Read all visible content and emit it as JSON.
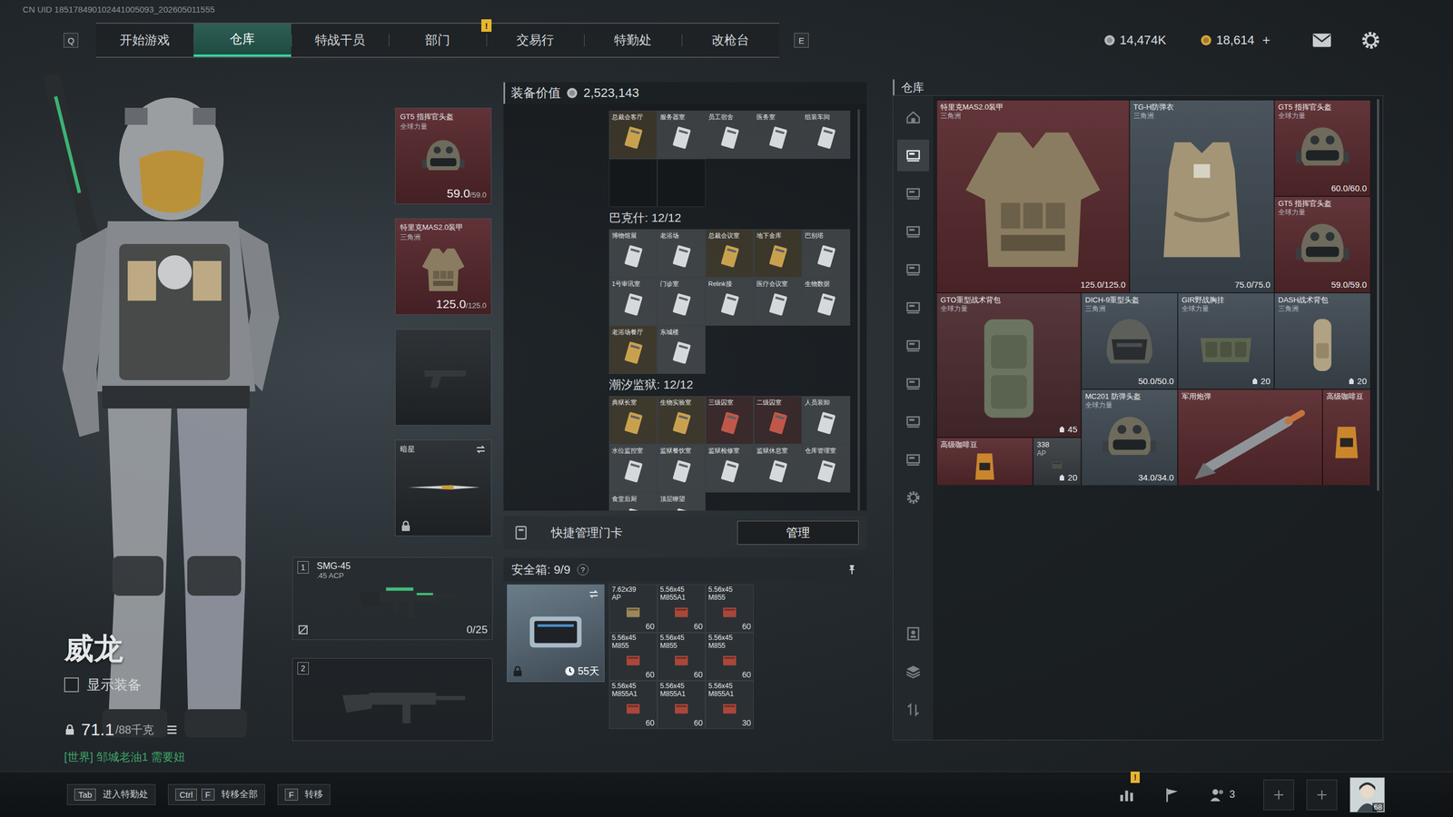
{
  "uid": "CN UID 185178490102441005093_202605011555",
  "nav": {
    "prev_key": "Q",
    "next_key": "E",
    "alert": "!",
    "tabs": [
      {
        "label": "开始游戏",
        "selected": false
      },
      {
        "label": "仓库",
        "selected": true
      },
      {
        "label": "特战干员",
        "selected": false
      },
      {
        "label": "部门",
        "selected": false
      },
      {
        "label": "交易行",
        "selected": false
      },
      {
        "label": "特勤处",
        "selected": false
      },
      {
        "label": "改枪台",
        "selected": false
      }
    ]
  },
  "currencies": [
    {
      "value": "14,474K",
      "color": "#b8bcc0"
    },
    {
      "value": "18,614",
      "add": "+",
      "color": "#d6a63a"
    }
  ],
  "operator": {
    "name": "威龙",
    "show_gear": {
      "label": "显示装备",
      "checked": false
    },
    "weight": "71.1",
    "weight_max": "/88千克"
  },
  "chat": "[世界] 邹城老油1 需要妞",
  "gear_slots": [
    {
      "kind": "helmet",
      "name": "GT5 指挥官头盔",
      "brand": "全球力量",
      "reading": "59.0",
      "reading_max": "/59.0",
      "color": "#5a2a2f"
    },
    {
      "kind": "armor",
      "name": "特里克MAS2.0装甲",
      "brand": "三角洲",
      "reading": "125.0",
      "reading_max": "/125.0",
      "color": "#5a2a2f"
    },
    {
      "kind": "pistol",
      "color": "#262b2f"
    },
    {
      "kind": "knife",
      "name": "暗星",
      "locked": true,
      "color": "#262b2f"
    }
  ],
  "weapons": [
    {
      "slot": "1",
      "name": "SMG-45",
      "caliber": ".45 ACP",
      "ammo": "0/25",
      "kind": "smg"
    },
    {
      "slot": "2",
      "kind": "rifle"
    }
  ],
  "equipment_value": {
    "label": "装备价值",
    "amount": "2,523,143"
  },
  "keycard_sections": [
    {
      "cards": [
        {
          "label": "总裁会客厅",
          "color": "#c9a14e"
        },
        {
          "label": "服务器室",
          "color": "#d5d9dc"
        },
        {
          "label": "员工宿舍",
          "color": "#d5d9dc"
        },
        {
          "label": "医务室",
          "color": "#d5d9dc"
        },
        {
          "label": "组装车间",
          "color": "#d5d9dc"
        }
      ]
    },
    {
      "title": "巴克什: 12/12",
      "cards": [
        {
          "label": "博物馆展",
          "color": "#d5d9dc"
        },
        {
          "label": "老浴场",
          "color": "#d5d9dc"
        },
        {
          "label": "总裁会议室",
          "color": "#c9a14e"
        },
        {
          "label": "地下金库",
          "color": "#c9a14e"
        },
        {
          "label": "巴别塔",
          "color": "#d5d9dc"
        },
        {
          "label": "1号审讯室",
          "color": "#d5d9dc"
        },
        {
          "label": "门诊室",
          "color": "#d5d9dc"
        },
        {
          "label": "Relink接",
          "color": "#d5d9dc"
        },
        {
          "label": "医疗会议室",
          "color": "#d5d9dc"
        },
        {
          "label": "生物数据",
          "color": "#d5d9dc"
        },
        {
          "label": "老浴场餐厅",
          "color": "#c9a14e"
        },
        {
          "label": "东城楼",
          "color": "#d5d9dc"
        }
      ]
    },
    {
      "title": "潮汐监狱: 12/12",
      "cards": [
        {
          "label": "典狱长室",
          "color": "#c9a14e"
        },
        {
          "label": "生物实验室",
          "color": "#c9a14e"
        },
        {
          "label": "三级囚室",
          "color": "#c0574a"
        },
        {
          "label": "二级囚室",
          "color": "#c0574a"
        },
        {
          "label": "人员装卸",
          "color": "#d5d9dc"
        },
        {
          "label": "水位监控室",
          "color": "#d5d9dc"
        },
        {
          "label": "监狱餐饮室",
          "color": "#d5d9dc"
        },
        {
          "label": "监狱检修室",
          "color": "#d5d9dc"
        },
        {
          "label": "监狱休息室",
          "color": "#d5d9dc"
        },
        {
          "label": "仓库管理室",
          "color": "#d5d9dc"
        },
        {
          "label": "食堂后厨",
          "color": "#d5d9dc"
        },
        {
          "label": "顶层瞭望",
          "color": "#d5d9dc"
        }
      ]
    }
  ],
  "quick_manage": {
    "label": "快捷管理门卡",
    "button": "管理"
  },
  "safebox": {
    "title": "安全箱: 9/9",
    "help": "?",
    "days": "55天",
    "locked": true,
    "items": [
      {
        "caliber": "7.62x39",
        "type": "AP",
        "count": "60",
        "color": "#9c8757"
      },
      {
        "caliber": "5.56x45",
        "type": "M855A1",
        "count": "60",
        "color": "#a8473a"
      },
      {
        "caliber": "5.56x45",
        "type": "M855",
        "count": "60",
        "color": "#a8473a"
      },
      {
        "caliber": "5.56x45",
        "type": "M855",
        "count": "60",
        "color": "#a8473a"
      },
      {
        "caliber": "5.56x45",
        "type": "M855",
        "count": "60",
        "color": "#a8473a"
      },
      {
        "caliber": "5.56x45",
        "type": "M855",
        "count": "60",
        "color": "#a8473a"
      },
      {
        "caliber": "5.56x45",
        "type": "M855A1",
        "count": "60",
        "color": "#a8473a"
      },
      {
        "caliber": "5.56x45",
        "type": "M855A1",
        "count": "60",
        "color": "#a8473a"
      },
      {
        "caliber": "5.56x45",
        "type": "M855A1",
        "count": "30",
        "color": "#a8473a"
      }
    ]
  },
  "stash": {
    "title": "仓库",
    "tabs": [
      {
        "selected": false
      },
      {
        "selected": true
      },
      {
        "selected": false
      },
      {
        "selected": false
      },
      {
        "selected": false
      },
      {
        "selected": false
      },
      {
        "selected": false
      },
      {
        "selected": false
      },
      {
        "selected": false
      },
      {
        "selected": false
      }
    ],
    "items": [
      {
        "name": "特里克MAS2.0装甲",
        "brand": "三角洲",
        "kind": "armor",
        "reading": "125.0/125.0",
        "color": "#5a2b2f"
      },
      {
        "name": "TG-H防弹衣",
        "brand": "三角洲",
        "kind": "vest",
        "reading": "75.0/75.0",
        "color": "#414b54"
      },
      {
        "name": "GT5 指挥官头盔",
        "brand": "全球力量",
        "kind": "helmet",
        "reading": "60.0/60.0",
        "color": "#5a2b2f"
      },
      {
        "name": "GT5 指挥官头盔",
        "brand": "全球力量",
        "kind": "helmet",
        "reading": "59.0/59.0",
        "color": "#5a2b2f"
      },
      {
        "name": "GTO重型战术背包",
        "brand": "全球力量",
        "kind": "backpack",
        "count": "45",
        "color": "#4e2d31"
      },
      {
        "name": "DICH-9重型头盔",
        "brand": "三角洲",
        "kind": "heavy-helmet",
        "reading": "50.0/50.0",
        "color": "#414b54"
      },
      {
        "name": "GIR野战胸挂",
        "brand": "全球力量",
        "kind": "rig",
        "count": "20",
        "color": "#414b54"
      },
      {
        "name": "DASH战术背包",
        "brand": "三角洲",
        "kind": "daypack",
        "count": "20",
        "color": "#414b54"
      },
      {
        "name": "高级咖啡豆",
        "kind": "coffee",
        "color": "#5a2b2f"
      },
      {
        "name": "338",
        "brand": "AP",
        "kind": "ammo",
        "count": "20",
        "color": "#3b3f44"
      },
      {
        "name": "MC201 防弹头盔",
        "brand": "全球力量",
        "kind": "helmet",
        "reading": "34.0/34.0",
        "color": "#414b54"
      },
      {
        "name": "军用炮弹",
        "kind": "shell",
        "color": "#5a2b2f"
      },
      {
        "name": "高级咖啡豆",
        "kind": "coffee",
        "color": "#5a2b2f"
      }
    ]
  },
  "hotkeys": [
    {
      "keys": [
        "Tab"
      ],
      "label": "进入特勤处"
    },
    {
      "keys": [
        "Ctrl",
        "F"
      ],
      "label": "转移全部"
    },
    {
      "keys": [
        "F"
      ],
      "label": "转移"
    }
  ],
  "social": {
    "alert": "!",
    "friends": "3",
    "level": "68"
  }
}
